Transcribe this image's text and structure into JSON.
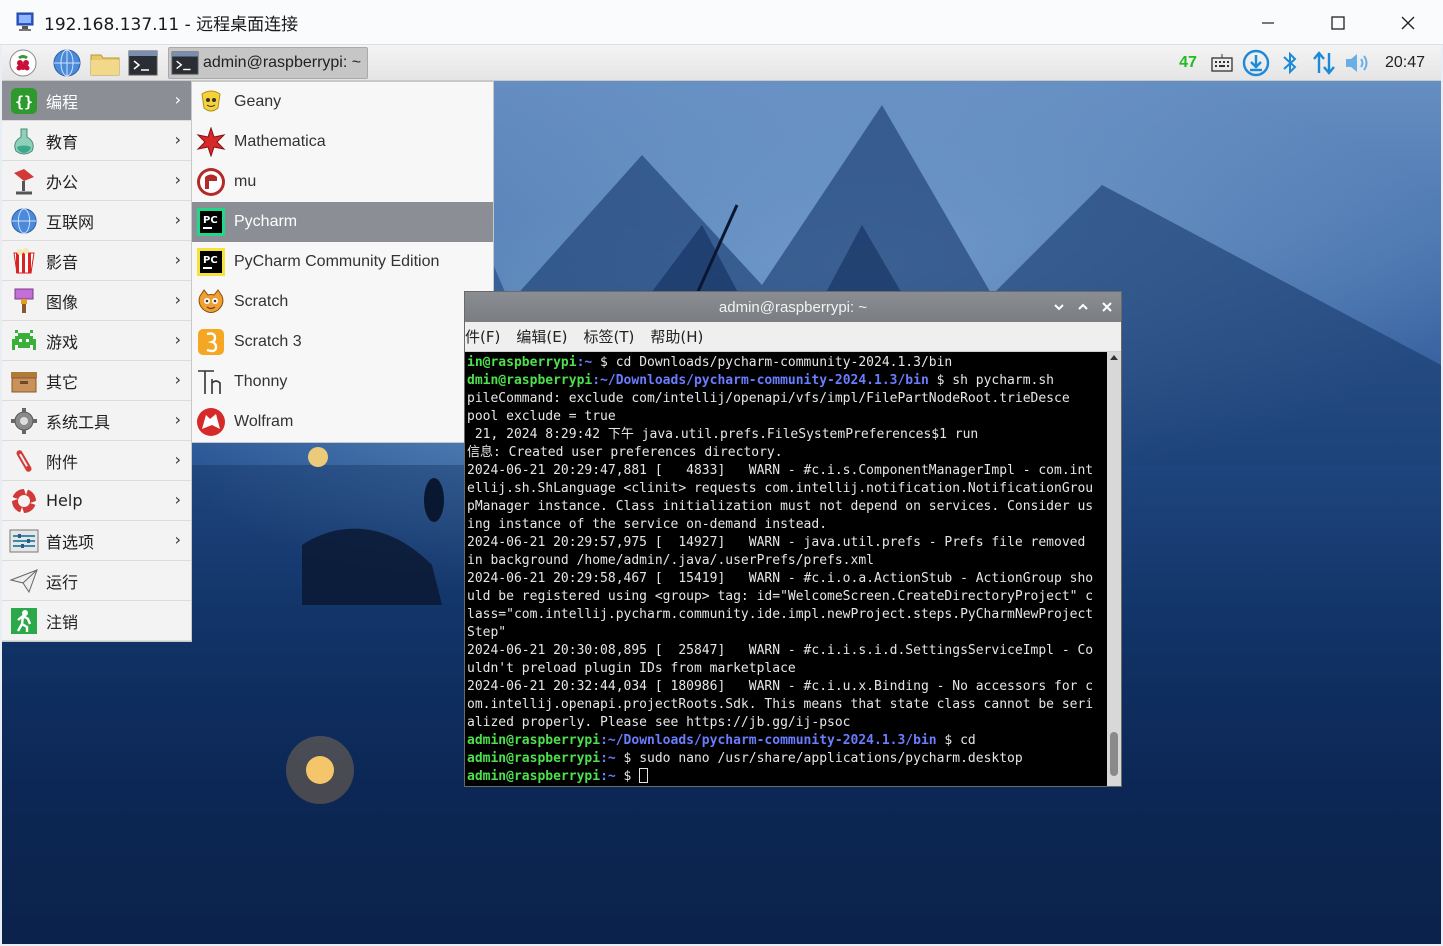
{
  "rdp": {
    "title": "192.168.137.11 - 远程桌面连接",
    "controls": [
      "minimize-icon",
      "maximize-icon",
      "close-icon"
    ]
  },
  "taskbar": {
    "launchers": [
      "raspberry-menu-icon",
      "web-browser-icon",
      "file-manager-icon",
      "terminal-icon"
    ],
    "task_label": "admin@raspberrypi: ~",
    "tray": {
      "cpu": "47",
      "icons": [
        "keyboard-icon",
        "download-icon",
        "bluetooth-icon",
        "network-icon",
        "volume-icon"
      ],
      "clock": "20:47"
    }
  },
  "main_menu": {
    "items": [
      {
        "label": "编程",
        "icon": "programming-icon",
        "submenu": true,
        "selected": true
      },
      {
        "label": "教育",
        "icon": "education-icon",
        "submenu": true
      },
      {
        "label": "办公",
        "icon": "office-icon",
        "submenu": true
      },
      {
        "label": "互联网",
        "icon": "internet-icon",
        "submenu": true
      },
      {
        "label": "影音",
        "icon": "media-icon",
        "submenu": true
      },
      {
        "label": "图像",
        "icon": "graphics-icon",
        "submenu": true
      },
      {
        "label": "游戏",
        "icon": "games-icon",
        "submenu": true
      },
      {
        "label": "其它",
        "icon": "other-icon",
        "submenu": true
      },
      {
        "label": "系统工具",
        "icon": "system-tools-icon",
        "submenu": true
      },
      {
        "label": "附件",
        "icon": "accessories-icon",
        "submenu": true
      },
      {
        "label": "Help",
        "icon": "help-icon",
        "submenu": true
      },
      {
        "label": "首选项",
        "icon": "preferences-icon",
        "submenu": true
      },
      {
        "label": "运行",
        "icon": "run-icon",
        "submenu": false
      },
      {
        "label": "注销",
        "icon": "logout-icon",
        "submenu": false
      }
    ]
  },
  "sub_menu": {
    "items": [
      {
        "label": "Geany",
        "icon": "geany-icon"
      },
      {
        "label": "Mathematica",
        "icon": "mathematica-icon"
      },
      {
        "label": "mu",
        "icon": "mu-icon"
      },
      {
        "label": "Pycharm",
        "icon": "pycharm-icon",
        "selected": true
      },
      {
        "label": "PyCharm Community Edition",
        "icon": "pycharm-ce-icon"
      },
      {
        "label": "Scratch",
        "icon": "scratch-icon"
      },
      {
        "label": "Scratch 3",
        "icon": "scratch3-icon"
      },
      {
        "label": "Thonny",
        "icon": "thonny-icon"
      },
      {
        "label": "Wolfram",
        "icon": "wolfram-icon"
      }
    ]
  },
  "terminal": {
    "title": "admin@raspberrypi: ~",
    "menus": [
      "件(F)",
      "编辑(E)",
      "标签(T)",
      "帮助(H)"
    ],
    "lines": [
      {
        "user": "in@raspberrypi",
        "path": ":~",
        "text": " $ cd Downloads/pycharm-community-2024.1.3/bin"
      },
      {
        "user": "dmin@raspberrypi",
        "path": ":~/Downloads/pycharm-community-2024.1.3/bin",
        "text": " $ sh pycharm.sh"
      },
      {
        "text": "pileCommand: exclude com/intellij/openapi/vfs/impl/FilePartNodeRoot.trieDesce"
      },
      {
        "text": "pool exclude = true"
      },
      {
        "text": " 21, 2024 8:29:42 下午 java.util.prefs.FileSystemPreferences$1 run"
      },
      {
        "text": "信息: Created user preferences directory."
      },
      {
        "text": "2024-06-21 20:29:47,881 [   4833]   WARN - #c.i.s.ComponentManagerImpl - com.int"
      },
      {
        "text": "ellij.sh.ShLanguage <clinit> requests com.intellij.notification.NotificationGrou"
      },
      {
        "text": "pManager instance. Class initialization must not depend on services. Consider us"
      },
      {
        "text": "ing instance of the service on-demand instead."
      },
      {
        "text": "2024-06-21 20:29:57,975 [  14927]   WARN - java.util.prefs - Prefs file removed"
      },
      {
        "text": "in background /home/admin/.java/.userPrefs/prefs.xml"
      },
      {
        "text": "2024-06-21 20:29:58,467 [  15419]   WARN - #c.i.o.a.ActionStub - ActionGroup sho"
      },
      {
        "text": "uld be registered using <group> tag: id=\"WelcomeScreen.CreateDirectoryProject\" c"
      },
      {
        "text": "lass=\"com.intellij.pycharm.community.ide.impl.newProject.steps.PyCharmNewProject"
      },
      {
        "text": "Step\""
      },
      {
        "text": "2024-06-21 20:30:08,895 [  25847]   WARN - #c.i.i.s.i.d.SettingsServiceImpl - Co"
      },
      {
        "text": "uldn't preload plugin IDs from marketplace"
      },
      {
        "text": "2024-06-21 20:32:44,034 [ 180986]   WARN - #c.i.u.x.Binding - No accessors for c"
      },
      {
        "text": "om.intellij.openapi.projectRoots.Sdk. This means that state class cannot be seri"
      },
      {
        "text": "alized properly. Please see https://jb.gg/ij-psoc"
      },
      {
        "user": "admin@raspberrypi",
        "path": ":~/Downloads/pycharm-community-2024.1.3/bin",
        "text": " $ cd"
      },
      {
        "user": "admin@raspberrypi",
        "path": ":~",
        "text": " $ sudo nano /usr/share/applications/pycharm.desktop"
      },
      {
        "user": "admin@raspberrypi",
        "path": ":~",
        "text": " $ ",
        "cursor": true
      }
    ]
  },
  "colors": {
    "menu_selected": "#8b8e94",
    "prompt_user": "#4de04d",
    "prompt_path": "#6a7cff",
    "cpu_text": "#22bb22"
  }
}
